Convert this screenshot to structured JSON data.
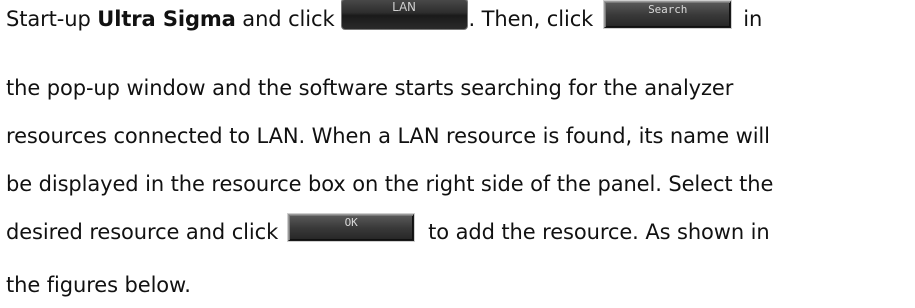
{
  "paragraph": {
    "l1_start": "Start-up ",
    "l1_app": "Ultra Sigma",
    "l1_and_click": " and click",
    "btn_lan": "LAN",
    "l1_then_click": ". Then, click",
    "btn_search": "Search",
    "l1_in": "in",
    "l2": "the pop-up window and the software starts searching for the analyzer",
    "l3": "resources connected to LAN. When a LAN resource is found, its name will",
    "l4": "be displayed in the resource box on the right side of the panel. Select the",
    "l5_start": "desired resource and click",
    "btn_ok": "OK",
    "l5_end": "to add the resource. As shown in",
    "l6": "the figures below."
  }
}
